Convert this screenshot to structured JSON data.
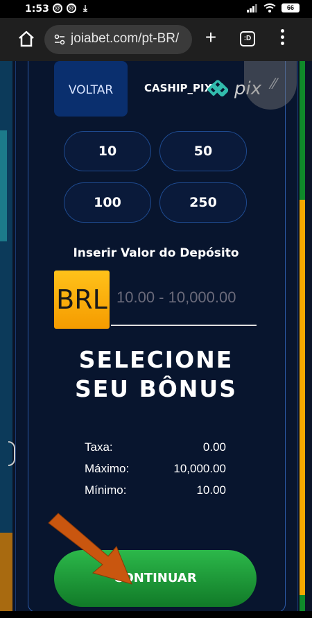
{
  "status": {
    "time": "1:53",
    "battery": "66"
  },
  "browser": {
    "url": "joiabet.com/pt-BR/",
    "tabs_count": ":D"
  },
  "deposit": {
    "back_label": "VOLTAR",
    "method": "CASHIP_PIX",
    "amounts": [
      "10",
      "50",
      "100",
      "250"
    ],
    "input_label": "Inserir Valor do Depósito",
    "currency": "BRL",
    "placeholder": "10.00 - 10,000.00",
    "bonus_title_line1": "SELECIONE",
    "bonus_title_line2": "SEU BÔNUS",
    "info": [
      {
        "label": "Taxa:",
        "value": "0.00"
      },
      {
        "label": "Máximo:",
        "value": "10,000.00"
      },
      {
        "label": "Mínimo:",
        "value": "10.00"
      }
    ],
    "continue_label": "CONTINUAR"
  },
  "colors": {
    "panel_bg": "#08152e",
    "accent_gold": "#f5a800",
    "continue_green": "#1f9a36",
    "back_button_blue": "#0a2f6e",
    "arrow_orange": "#c9560f"
  }
}
